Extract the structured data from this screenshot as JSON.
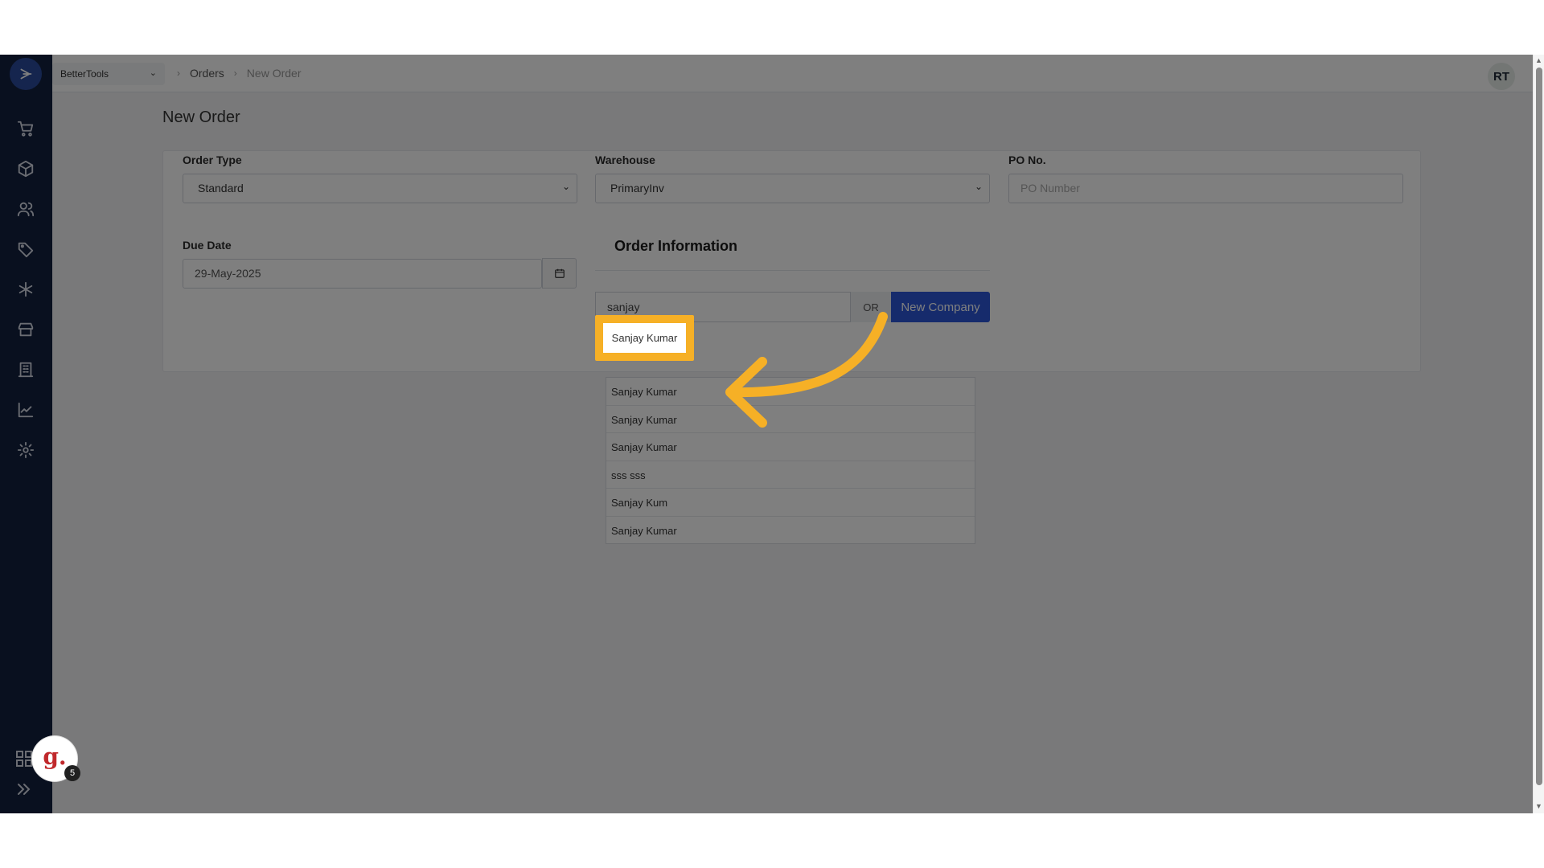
{
  "org": {
    "name": "BetterTools"
  },
  "breadcrumb": {
    "items": [
      "Orders",
      "New Order"
    ]
  },
  "user": {
    "initials": "RT"
  },
  "page": {
    "title": "New Order"
  },
  "form": {
    "order_type": {
      "label": "Order Type",
      "value": "Standard"
    },
    "warehouse": {
      "label": "Warehouse",
      "value": "PrimaryInv"
    },
    "po": {
      "label": "PO No.",
      "placeholder": "PO Number"
    },
    "due_date": {
      "label": "Due Date",
      "value": "29-May-2025"
    }
  },
  "order_info": {
    "title": "Order Information",
    "search_value": "sanjay",
    "or_label": "OR",
    "new_company_label": "New Company"
  },
  "dropdown": {
    "items": [
      "Sanjay Kumar",
      "Sanjay Kumar",
      "Sanjay Kumar",
      "sss sss",
      "Sanjay Kum",
      "Sanjay Kumar"
    ]
  },
  "highlight": {
    "label": "Sanjay Kumar"
  },
  "guide_badge": {
    "count": "5",
    "letter": "g."
  },
  "colors": {
    "accent": "#2c57d8",
    "highlight": "#f6b026",
    "sidebar": "#13213f"
  }
}
